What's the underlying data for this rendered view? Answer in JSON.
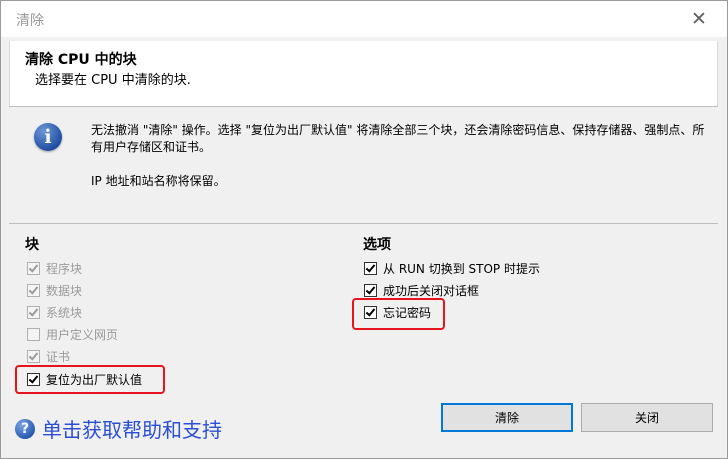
{
  "window": {
    "title": "清除"
  },
  "header": {
    "title": "清除 CPU 中的块",
    "subtitle": "选择要在 CPU 中清除的块."
  },
  "info": {
    "line1": "无法撤消 \"清除\" 操作。选择 \"复位为出厂默认值\" 将清除全部三个块，还会清除密码信息、保持存储器、强制点、所有用户存储区和证书。",
    "line2": "IP 地址和站名称将保留。"
  },
  "blocks": {
    "title": "块",
    "items": [
      {
        "label": "程序块",
        "checked": true,
        "enabled": false
      },
      {
        "label": "数据块",
        "checked": true,
        "enabled": false
      },
      {
        "label": "系统块",
        "checked": true,
        "enabled": false
      },
      {
        "label": "用户定义网页",
        "checked": false,
        "enabled": false
      },
      {
        "label": "证书",
        "checked": true,
        "enabled": false
      },
      {
        "label": "复位为出厂默认值",
        "checked": true,
        "enabled": true
      }
    ]
  },
  "options": {
    "title": "选项",
    "items": [
      {
        "label": "从 RUN 切换到 STOP 时提示",
        "checked": true,
        "enabled": true
      },
      {
        "label": "成功后关闭对话框",
        "checked": true,
        "enabled": true
      },
      {
        "label": "忘记密码",
        "checked": true,
        "enabled": true
      }
    ]
  },
  "help": {
    "label": "单击获取帮助和支持"
  },
  "buttons": {
    "clear": "清除",
    "close": "关闭"
  },
  "colors": {
    "highlight": "#e8141c",
    "link": "#2a4fd6",
    "focus": "#0078d7"
  }
}
